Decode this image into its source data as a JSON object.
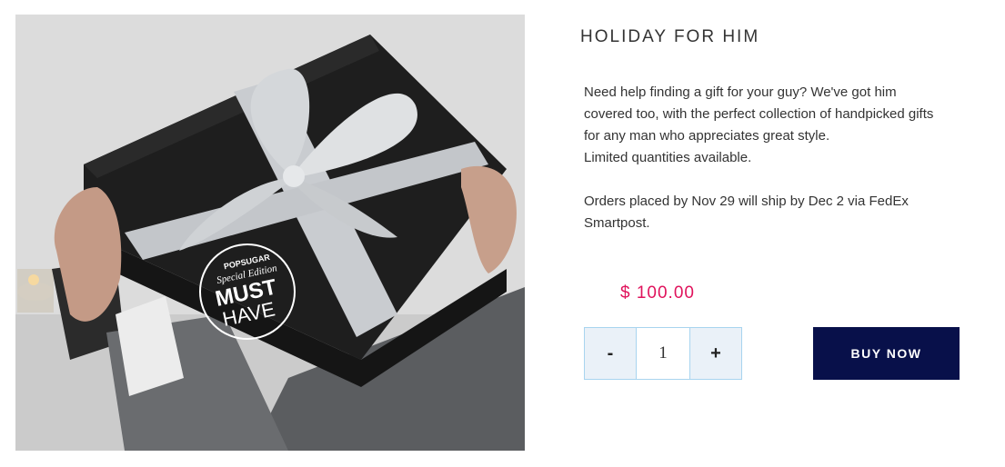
{
  "product": {
    "title": "HOLIDAY FOR HIM",
    "description_lines": [
      "Need help finding a gift for your guy? We've got him",
      "covered too, with the perfect collection of handpicked gifts",
      "for any man who appreciates great style.",
      "Limited quantities available."
    ],
    "shipping_lines": [
      "Orders placed by Nov 29 will ship by Dec 2 via FedEx",
      "Smartpost."
    ],
    "price": "$ 100.00",
    "image": {
      "badge_brand": "POPSUGAR",
      "badge_line1": "Special Edition",
      "badge_line2": "MUST",
      "badge_line3": "HAVE"
    }
  },
  "quantity": {
    "minus_label": "-",
    "value": "1",
    "plus_label": "+"
  },
  "buy_button": {
    "label": "BUY NOW"
  },
  "colors": {
    "price": "#e0135c",
    "buy_button_bg": "#08104a",
    "qty_border": "#a8d4ef",
    "qty_button_bg": "#eaf1f8"
  }
}
